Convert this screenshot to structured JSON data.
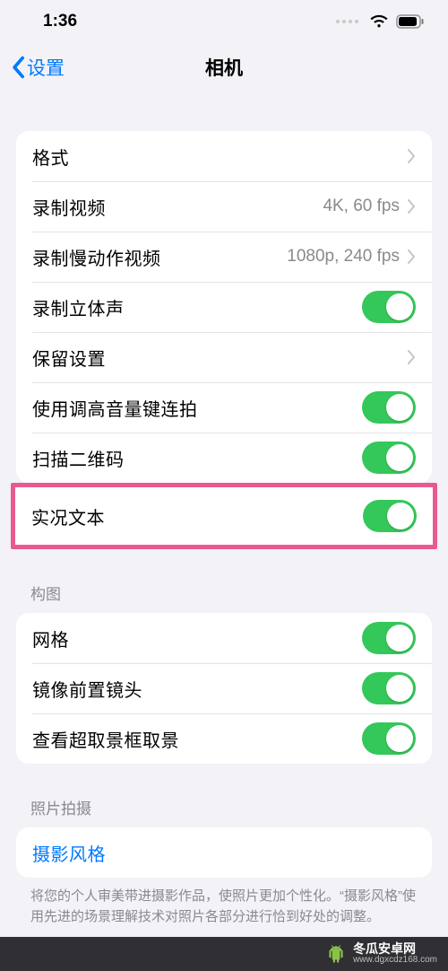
{
  "status": {
    "time": "1:36"
  },
  "nav": {
    "back": "设置",
    "title": "相机"
  },
  "group1": {
    "format": "格式",
    "record_video": "录制视频",
    "record_video_value": "4K, 60 fps",
    "record_slomo": "录制慢动作视频",
    "record_slomo_value": "1080p, 240 fps",
    "stereo": "录制立体声",
    "preserve": "保留设置",
    "volume_burst": "使用调高音量键连拍",
    "scan_qr": "扫描二维码",
    "live_text": "实况文本"
  },
  "composition": {
    "header": "构图",
    "grid": "网格",
    "mirror_front": "镜像前置镜头",
    "view_outside": "查看超取景框取景"
  },
  "photo_capture": {
    "header": "照片拍摄",
    "photographic_styles": "摄影风格",
    "footer": "将您的个人审美带进摄影作品，使照片更加个性化。“摄影风格”使用先进的场景理解技术对照片各部分进行恰到好处的调整。"
  },
  "watermark": {
    "name": "冬瓜安卓网",
    "url": "www.dgxcdz168.com"
  }
}
